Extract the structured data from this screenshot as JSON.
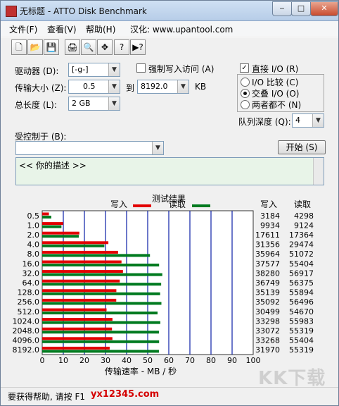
{
  "window": {
    "title": "无标题 - ATTO Disk Benchmark",
    "buttons": {
      "minimize": "‒",
      "maximize": "□",
      "close": "✕"
    }
  },
  "menu": [
    "文件(F)",
    "查看(V)",
    "帮助(H)",
    "汉化: www.upantool.com"
  ],
  "toolbar": {
    "icons": [
      "new-file-icon",
      "open-folder-icon",
      "save-icon",
      "print-icon",
      "print-preview-icon",
      "move-icon",
      "help-icon",
      "context-help-icon"
    ],
    "glyphs": [
      "🗋",
      "📂",
      "💾",
      "🖨",
      "🔍",
      "✥",
      "?",
      "▶?"
    ]
  },
  "settings": {
    "drive_label": "驱动器 (D):",
    "drive_value": "[-g-]",
    "transfer_label": "传输大小 (Z):",
    "transfer_from": "0.5",
    "to_label": "到",
    "transfer_to": "8192.0",
    "transfer_unit": "KB",
    "length_label": "总长度 (L):",
    "length_value": "2 GB",
    "force_write_label": "强制写入访问 (A)",
    "direct_io_label": "直接 I/O (R)",
    "io_compare_label": "I/O 比较 (C)",
    "overlap_io_label": "交叠 I/O (O)",
    "neither_label": "两者都不 (N)",
    "queue_label": "队列深度 (Q):",
    "queue_value": "4",
    "controlled_by_label": "受控制于 (B):",
    "controlled_by_value": "",
    "start_button": "开始 (S)",
    "description": "<<   你的描述   >>"
  },
  "results": {
    "title": "测试结果",
    "legend_write": "写入",
    "legend_read": "读取",
    "col_write": "写入",
    "col_read": "读取",
    "xlabel": "传输速率 - MB / 秒",
    "write_values": [
      "3184",
      "9934",
      "17611",
      "31356",
      "35964",
      "37577",
      "38280",
      "36749",
      "35139",
      "35092",
      "30499",
      "33298",
      "33072",
      "33268",
      "31970"
    ],
    "read_values": [
      "4298",
      "9124",
      "17364",
      "29474",
      "51072",
      "55404",
      "56917",
      "56375",
      "55894",
      "56496",
      "54670",
      "55983",
      "55319",
      "55404",
      "55319"
    ]
  },
  "chart_data": {
    "type": "bar",
    "orientation": "horizontal",
    "title": "测试结果",
    "xlabel": "传输速率 - MB / 秒",
    "ylabel": "",
    "xlim": [
      0,
      100
    ],
    "xticks": [
      0,
      10,
      20,
      30,
      40,
      50,
      60,
      70,
      80,
      90,
      100
    ],
    "categories": [
      "0.5",
      "1.0",
      "2.0",
      "4.0",
      "8.0",
      "16.0",
      "32.0",
      "64.0",
      "128.0",
      "256.0",
      "512.0",
      "1024.0",
      "2048.0",
      "4096.0",
      "8192.0"
    ],
    "series": [
      {
        "name": "写入",
        "color": "#e30000",
        "values": [
          3.18,
          9.93,
          17.61,
          31.36,
          35.96,
          37.58,
          38.28,
          36.75,
          35.14,
          35.09,
          30.5,
          33.3,
          33.07,
          33.27,
          31.97
        ]
      },
      {
        "name": "读取",
        "color": "#007a1f",
        "values": [
          4.3,
          9.12,
          17.36,
          29.47,
          51.07,
          55.4,
          56.92,
          56.38,
          55.89,
          56.5,
          54.67,
          55.98,
          55.32,
          55.4,
          55.32
        ]
      }
    ],
    "grid": true,
    "grid_color": "#0b1fa6",
    "legend": "top"
  },
  "status": {
    "help_text": "要获得帮助, 请按 F1",
    "site_text": "yx12345.com",
    "watermark": "KK下载"
  }
}
